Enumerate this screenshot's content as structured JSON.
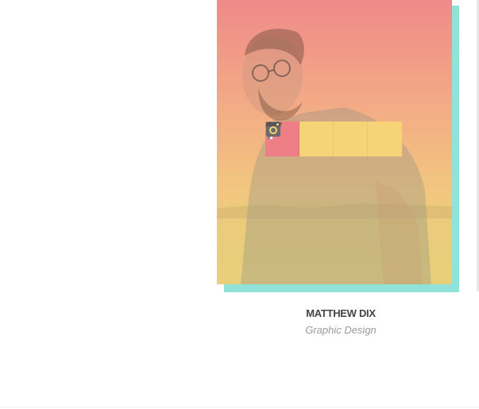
{
  "member": {
    "name": "MATTHEW DIX",
    "role": "Graphic Design"
  },
  "social": [
    {
      "icon": "facebook-icon",
      "active": true
    },
    {
      "icon": "twitter-icon",
      "active": false
    },
    {
      "icon": "pinterest-icon",
      "active": false
    },
    {
      "icon": "instagram-icon",
      "active": false
    }
  ],
  "colors": {
    "gradient_top": "#ef8a89",
    "gradient_bottom": "#ead57c",
    "accent_shadow": "#8fe3d8",
    "social_active": "#ef7f86",
    "social_default": "#f7d378"
  }
}
